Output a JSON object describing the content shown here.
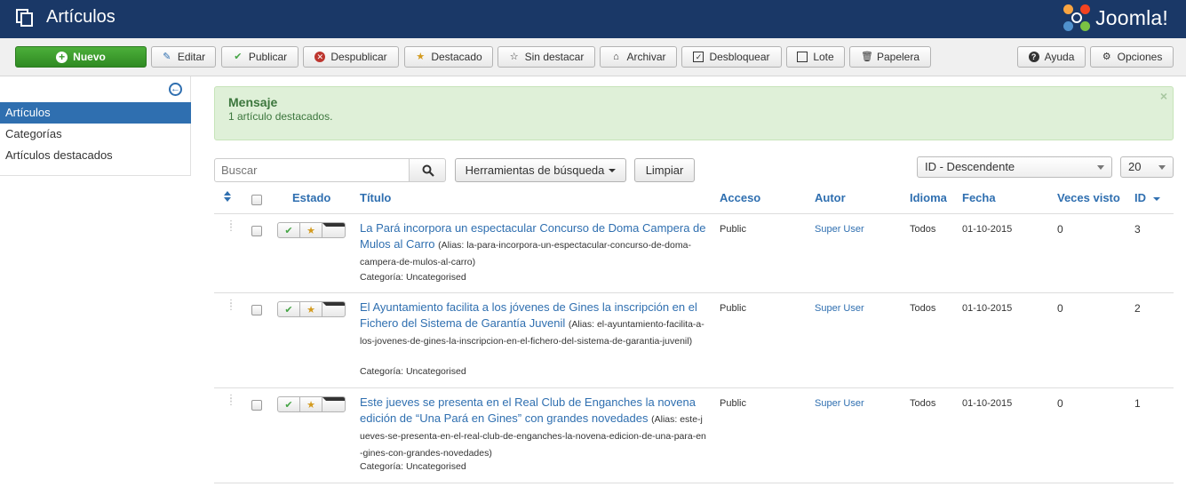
{
  "header": {
    "title": "Artículos",
    "brand": "Joomla!"
  },
  "toolbar": {
    "new": "Nuevo",
    "edit": "Editar",
    "publish": "Publicar",
    "unpublish": "Despublicar",
    "feature": "Destacado",
    "unfeature": "Sin destacar",
    "archive": "Archivar",
    "checkin": "Desbloquear",
    "batch": "Lote",
    "trash": "Papelera",
    "help": "Ayuda",
    "options": "Opciones"
  },
  "sidebar": {
    "items": [
      {
        "label": "Artículos",
        "active": true
      },
      {
        "label": "Categorías",
        "active": false
      },
      {
        "label": "Artículos destacados",
        "active": false
      }
    ]
  },
  "message": {
    "heading": "Mensaje",
    "text": "1 artículo destacados."
  },
  "filters": {
    "search_placeholder": "Buscar",
    "search_tools": "Herramientas de búsqueda",
    "clear": "Limpiar",
    "ordering": "ID - Descendente",
    "limit": "20"
  },
  "table": {
    "headers": {
      "status": "Estado",
      "title": "Título",
      "access": "Acceso",
      "author": "Autor",
      "language": "Idioma",
      "date": "Fecha",
      "hits": "Veces visto",
      "id": "ID"
    },
    "rows": [
      {
        "title": "La Pará incorpora un espectacular Concurso de Doma Campera de Mulos al Carro",
        "alias": "(Alias: la-para-incorpora-un-espectacular-concurso-de-doma-campera-de-mulos-al-carro)",
        "category": "Categoría: Uncategorised",
        "access": "Public",
        "author": "Super User",
        "language": "Todos",
        "date": "01-10-2015",
        "hits": "0",
        "id": "3"
      },
      {
        "title": "El Ayuntamiento facilita a los jóvenes de Gines la inscripción en el Fichero del Sistema de Garantía Juvenil",
        "alias": "(Alias: el-ayuntamiento-facilita-a-los-jovenes-de-gines-la-inscripcion-en-el-fichero-del-sistema-de-garantia-juvenil)",
        "category": "Categoría: Uncategorised",
        "access": "Public",
        "author": "Super User",
        "language": "Todos",
        "date": "01-10-2015",
        "hits": "0",
        "id": "2"
      },
      {
        "title": "Este jueves se presenta en el Real Club de Enganches la novena edición de “Una Pará en Gines” con grandes novedades",
        "alias": "(Alias: este-jueves-se-presenta-en-el-real-club-de-enganches-la-novena-edicion-de-una-para-en-gines-con-grandes-novedades)",
        "category": "Categoría: Uncategorised",
        "access": "Public",
        "author": "Super User",
        "language": "Todos",
        "date": "01-10-2015",
        "hits": "0",
        "id": "1"
      }
    ]
  },
  "colors": {
    "header": "#1a3867",
    "accent": "#2f6fb0",
    "success": "#3c763d",
    "new_button": "#3a9a2c",
    "featured_star": "#d39a1e",
    "published_check": "#46a546"
  }
}
